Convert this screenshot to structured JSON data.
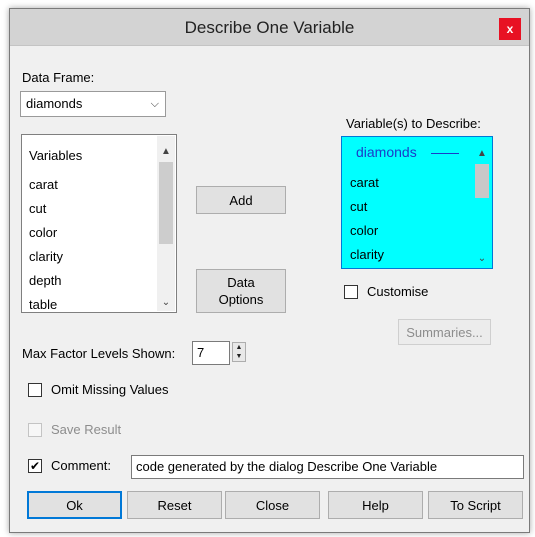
{
  "window": {
    "title": "Describe One Variable",
    "close_label": "x"
  },
  "data_frame": {
    "label": "Data Frame:",
    "value": "diamonds"
  },
  "variables": {
    "header": "Variables",
    "items": [
      "carat",
      "cut",
      "color",
      "clarity",
      "depth",
      "table"
    ]
  },
  "buttons": {
    "add": "Add",
    "data_options": "Data Options",
    "summaries": "Summaries..."
  },
  "target": {
    "label": "Variable(s) to Describe:",
    "header": "diamonds",
    "items": [
      "carat",
      "cut",
      "color",
      "clarity"
    ],
    "background_color": "#00ffff"
  },
  "customise": {
    "label": "Customise",
    "checked": false
  },
  "max_factor": {
    "label": "Max Factor Levels Shown:",
    "value": "7"
  },
  "omit_missing": {
    "label": "Omit Missing Values",
    "checked": false
  },
  "save_result": {
    "label": "Save Result",
    "checked": false,
    "enabled": false
  },
  "comment": {
    "label": "Comment:",
    "checked": true,
    "value": "code generated by the dialog Describe One Variable"
  },
  "footer": {
    "ok": "Ok",
    "reset": "Reset",
    "close": "Close",
    "help": "Help",
    "to_script": "To Script"
  },
  "icons": {
    "dropdown": "chevron-down-icon",
    "scroll_up": "arrow-up-icon",
    "scroll_down": "chevron-down-icon",
    "check": "check-icon"
  }
}
